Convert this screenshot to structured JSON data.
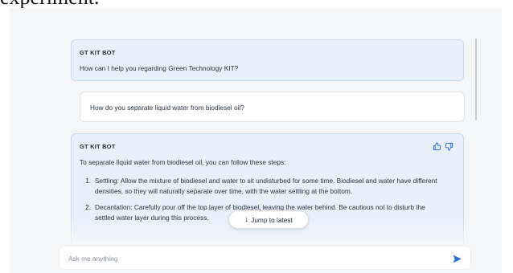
{
  "caption": "experiment.",
  "colors": {
    "accent": "#2f6fde",
    "bot_bubble": "#e7f0fb",
    "bot_border": "#c6daf4",
    "user_bubble": "#ffffff"
  },
  "conversation": {
    "messages": [
      {
        "role": "bot",
        "sender": "GT KIT BOT",
        "text": "How can I help you regarding Green Technology KIT?"
      },
      {
        "role": "user",
        "text": "How do you separate liquid water from biodiesel oil?"
      },
      {
        "role": "bot",
        "sender": "GT KIT BOT",
        "intro": "To separate liquid water from biodiesel oil, you can follow these steps:",
        "steps": [
          {
            "num": "1.",
            "text": "Settling: Allow the mixture of biodiesel and water to sit undisturbed for some time. Biodiesel and water have different densities, so they will naturally separate over time, with the water settling at the bottom."
          },
          {
            "num": "2.",
            "text": "Decantation: Carefully pour off the top layer of biodiesel, leaving the water behind. Be cautious not to disturb the settled water layer during this process."
          }
        ],
        "feedback_icons": [
          "thumbs-up-icon",
          "thumbs-down-icon"
        ]
      }
    ]
  },
  "jump_button": {
    "label": "Jump to latest",
    "icon": "arrow-down-icon"
  },
  "input": {
    "placeholder": "Ask me anything",
    "value": "",
    "send_icon": "send-icon"
  }
}
